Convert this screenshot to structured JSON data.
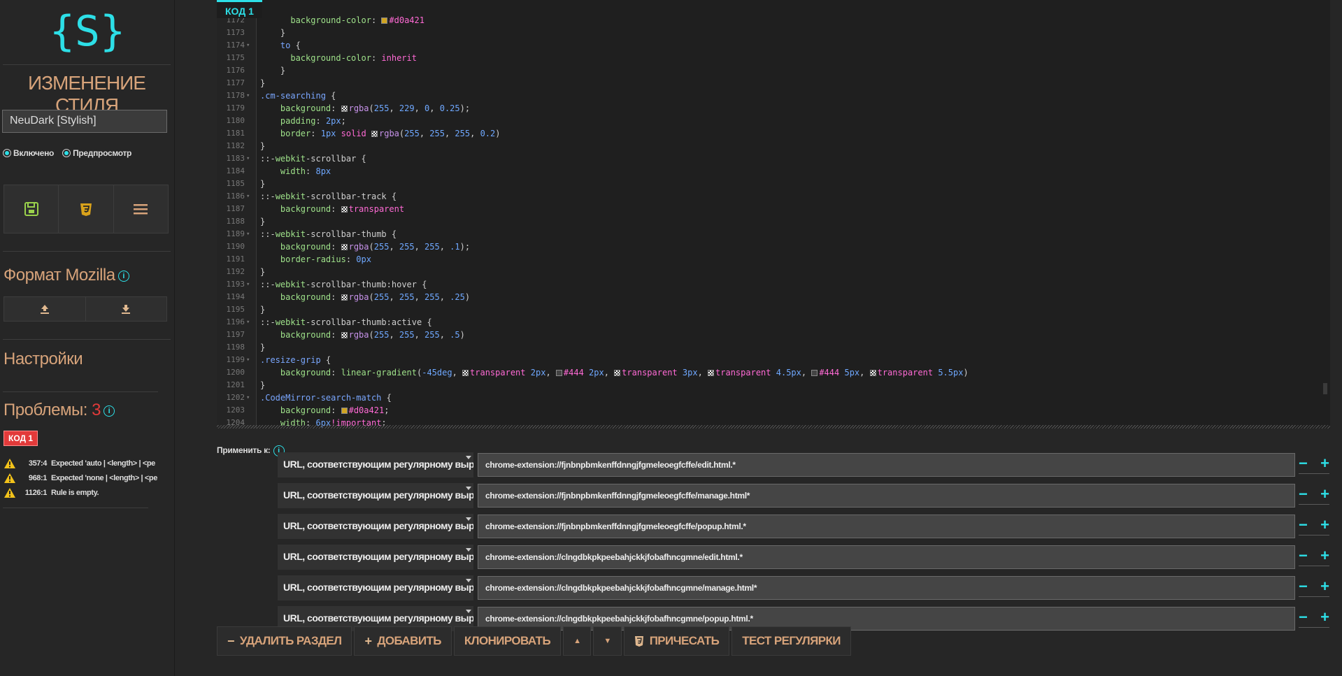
{
  "sidebar": {
    "logo": "{S}",
    "title": "ИЗМЕНЕНИЕ СТИЛЯ",
    "style_name": "NeuDark [Stylish]",
    "enabled_label": "Включено",
    "preview_label": "Предпросмотр",
    "mozilla_heading": "Формат Mozilla",
    "settings_heading": "Настройки",
    "problems_heading": "Проблемы:",
    "problems_count": "3",
    "section_badge": "КОД 1",
    "problems": [
      {
        "loc": "357:4",
        "msg": "Expected 'auto | <length> | <pe"
      },
      {
        "loc": "968:1",
        "msg": "Expected 'none | <length> | <pe"
      },
      {
        "loc": "1126:1",
        "msg": "Rule is empty."
      }
    ]
  },
  "editor": {
    "tab_label": "КОД 1",
    "lines": [
      {
        "n": "1172",
        "m": "",
        "html": "      <span class='prop'>background-color</span>: <span class='sw sw-gold'></span><span class='val'>#d0a421</span>"
      },
      {
        "n": "1173",
        "m": "",
        "html": "    }"
      },
      {
        "n": "1174",
        "m": "▾",
        "html": "    <span class='kw'>to</span> {"
      },
      {
        "n": "1175",
        "m": "",
        "html": "      <span class='prop'>background-color</span>: <span class='val'>inherit</span>"
      },
      {
        "n": "1176",
        "m": "",
        "html": "    }"
      },
      {
        "n": "1177",
        "m": "",
        "html": "}"
      },
      {
        "n": "1178",
        "m": "▾",
        "html": "<span class='sel'>.cm-searching</span> {"
      },
      {
        "n": "1179",
        "m": "",
        "html": "    <span class='prop'>background</span>: <span class='sw sw-check'></span><span class='fn'>rgba</span>(<span class='num'>255</span>, <span class='num'>229</span>, <span class='num'>0</span>, <span class='num'>0.25</span>);"
      },
      {
        "n": "1180",
        "m": "",
        "html": "    <span class='prop'>padding</span>: <span class='num'>2px</span>;"
      },
      {
        "n": "1181",
        "m": "",
        "html": "    <span class='prop'>border</span>: <span class='num'>1px</span> <span class='val'>solid</span> <span class='sw sw-check'></span><span class='fn'>rgba</span>(<span class='num'>255</span>, <span class='num'>255</span>, <span class='num'>255</span>, <span class='num'>0.2</span>)"
      },
      {
        "n": "1182",
        "m": "",
        "html": "}"
      },
      {
        "n": "1183",
        "m": "▾",
        "html": "::-<span class='prop'>webkit</span>-scrollbar {"
      },
      {
        "n": "1184",
        "m": "",
        "html": "    <span class='prop'>width</span>: <span class='num'>8px</span>"
      },
      {
        "n": "1185",
        "m": "",
        "html": "}"
      },
      {
        "n": "1186",
        "m": "▾",
        "html": "::-<span class='prop'>webkit</span>-scrollbar-track {"
      },
      {
        "n": "1187",
        "m": "",
        "html": "    <span class='prop'>background</span>: <span class='sw sw-check'></span><span class='val'>transparent</span>"
      },
      {
        "n": "1188",
        "m": "",
        "html": "}"
      },
      {
        "n": "1189",
        "m": "▾",
        "html": "::-<span class='prop'>webkit</span>-scrollbar-thumb {"
      },
      {
        "n": "1190",
        "m": "",
        "html": "    <span class='prop'>background</span>: <span class='sw sw-check'></span><span class='fn'>rgba</span>(<span class='num'>255</span>, <span class='num'>255</span>, <span class='num'>255</span>, <span class='num'>.1</span>);"
      },
      {
        "n": "1191",
        "m": "",
        "html": "    <span class='prop'>border-radius</span>: <span class='num'>0px</span>"
      },
      {
        "n": "1192",
        "m": "",
        "html": "}"
      },
      {
        "n": "1193",
        "m": "▾",
        "html": "::-<span class='prop'>webkit</span>-scrollbar-thumb:hover {"
      },
      {
        "n": "1194",
        "m": "",
        "html": "    <span class='prop'>background</span>: <span class='sw sw-check'></span><span class='fn'>rgba</span>(<span class='num'>255</span>, <span class='num'>255</span>, <span class='num'>255</span>, <span class='num'>.25</span>)"
      },
      {
        "n": "1195",
        "m": "",
        "html": "}"
      },
      {
        "n": "1196",
        "m": "▾",
        "html": "::-<span class='prop'>webkit</span>-scrollbar-thumb:active {"
      },
      {
        "n": "1197",
        "m": "",
        "html": "    <span class='prop'>background</span>: <span class='sw sw-check'></span><span class='fn'>rgba</span>(<span class='num'>255</span>, <span class='num'>255</span>, <span class='num'>255</span>, <span class='num'>.5</span>)"
      },
      {
        "n": "1198",
        "m": "",
        "html": "}"
      },
      {
        "n": "1199",
        "m": "▾",
        "html": "<span class='sel'>.resize-grip</span> {"
      },
      {
        "n": "1200",
        "m": "",
        "html": "    <span class='prop'>background</span>: <span class='prop'>linear-gradient</span>(<span class='num'>-45deg</span>, <span class='sw sw-check'></span><span class='val'>transparent</span> <span class='num'>2px</span>, <span class='sw sw-gray'></span><span class='val'>#444</span> <span class='num'>2px</span>, <span class='sw sw-check'></span><span class='val'>transparent</span> <span class='num'>3px</span>, <span class='sw sw-check'></span><span class='val'>transparent</span> <span class='num'>4.5px</span>, <span class='sw sw-gray'></span><span class='val'>#444</span> <span class='num'>5px</span>, <span class='sw sw-check'></span><span class='val'>transparent</span> <span class='num'>5.5px</span>)"
      },
      {
        "n": "1201",
        "m": "",
        "html": "}"
      },
      {
        "n": "1202",
        "m": "▾",
        "html": "<span class='sel'>.CodeMirror-search-match</span> {"
      },
      {
        "n": "1203",
        "m": "",
        "html": "    <span class='prop'>background</span>: <span class='sw sw-gold'></span><span class='val'>#d0a421</span>;"
      },
      {
        "n": "1204",
        "m": "",
        "html": "    <span class='prop'>width</span>: <span class='num'>6px</span><span class='val'>!important</span>;"
      }
    ]
  },
  "applies": {
    "label": "Применить к:",
    "rows": [
      {
        "type": "URL, соответствующим регулярному выражению",
        "value": "chrome-extension://fjnbnpbmkenffdnngjfgmeleoegfcffe/edit.html.*"
      },
      {
        "type": "URL, соответствующим регулярному выражению",
        "value": "chrome-extension://fjnbnpbmkenffdnngjfgmeleoegfcffe/manage.html*"
      },
      {
        "type": "URL, соответствующим регулярному выражению",
        "value": "chrome-extension://fjnbnpbmkenffdnngjfgmeleoegfcffe/popup.html.*"
      },
      {
        "type": "URL, соответствующим регулярному выражению",
        "value": "chrome-extension://clngdbkpkpeebahjckkjfobafhncgmne/edit.html.*"
      },
      {
        "type": "URL, соответствующим регулярному выражению",
        "value": "chrome-extension://clngdbkpkpeebahjckkjfobafhncgmne/manage.html*"
      },
      {
        "type": "URL, соответствующим регулярному выражению",
        "value": "chrome-extension://clngdbkpkpeebahjckkjfobafhncgmne/popup.html.*"
      }
    ],
    "minus": "−",
    "plus": "+"
  },
  "buttons": {
    "delete": "УДАЛИТЬ РАЗДЕЛ",
    "delete_icon": "−",
    "add": "ДОБАВИТЬ",
    "add_icon": "+",
    "clone": "КЛОНИРОВАТЬ",
    "up": "▲",
    "down": "▼",
    "beautify": "ПРИЧЕСАТЬ",
    "regex_test": "ТЕСТ РЕГУЛЯРКИ"
  },
  "colors": {
    "accent": "#2ddfe7",
    "heading": "#d7a37a",
    "error": "#e23a3a"
  }
}
